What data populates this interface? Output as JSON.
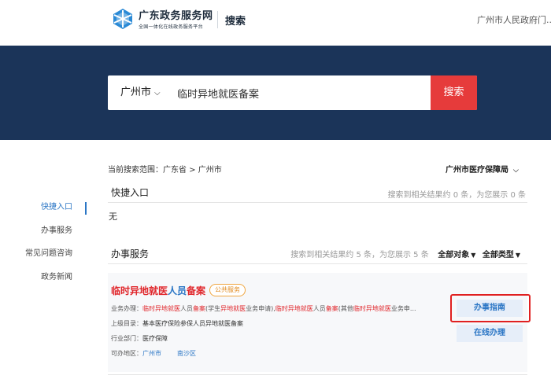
{
  "header": {
    "brand_title": "广东政务服务网",
    "brand_subtitle": "全国一体化在线政务服务平台",
    "search_label": "搜索",
    "gov_link": "广州市人民政府门..."
  },
  "search": {
    "city": "广州市",
    "query": "临时异地就医备案",
    "button_label": "搜索"
  },
  "left_nav": {
    "items": [
      {
        "label": "快捷入口",
        "active": true
      },
      {
        "label": "办事服务",
        "active": false
      },
      {
        "label": "常见问题咨询",
        "active": false
      },
      {
        "label": "政务新闻",
        "active": false
      }
    ]
  },
  "scope": {
    "text": "当前搜索范围：广东省 > 广州市",
    "bureau": "广州市医疗保障局"
  },
  "quick_entry": {
    "title": "快捷入口",
    "count_text": "搜索到相关结果约 0 条，为您展示 0 条",
    "empty_text": "无"
  },
  "services": {
    "title": "办事服务",
    "count_text": "搜索到相关结果约 5 条，为您展示 5 条",
    "filter_object": "全部对象",
    "filter_type": "全部类型",
    "card": {
      "title_part1": "临时异地就医",
      "title_part2": "人员",
      "title_part3": "备案",
      "tag": "公共服务",
      "business_label": "业务办理：",
      "business_segments": [
        {
          "t": "临时异地就医",
          "hl": true
        },
        {
          "t": "人员",
          "hl": false
        },
        {
          "t": "备案",
          "hl": true
        },
        {
          "t": "(学生",
          "hl": false
        },
        {
          "t": "异地就医",
          "hl": true
        },
        {
          "t": "业务申请),",
          "hl": false
        },
        {
          "t": "临时异地就医",
          "hl": true
        },
        {
          "t": "人员",
          "hl": false
        },
        {
          "t": "备案",
          "hl": true
        },
        {
          "t": "(其他",
          "hl": false
        },
        {
          "t": "临时异地就医",
          "hl": true
        },
        {
          "t": "业务申...",
          "hl": false
        }
      ],
      "parent_label": "上级目录：",
      "parent_value": "基本医疗保险参保人员异地就医备案",
      "dept_label": "行业部门：",
      "dept_value": "医疗保障",
      "area_label": "可办地区：",
      "areas": [
        "广州市",
        "南沙区"
      ],
      "guide_button": "办事指南",
      "online_button": "在线办理"
    }
  },
  "colors": {
    "banner": "#1b3459",
    "search_button": "#e63b3b",
    "accent_blue": "#2b76c5",
    "highlight_red": "#e0262b",
    "tag_orange": "#f0a640"
  }
}
